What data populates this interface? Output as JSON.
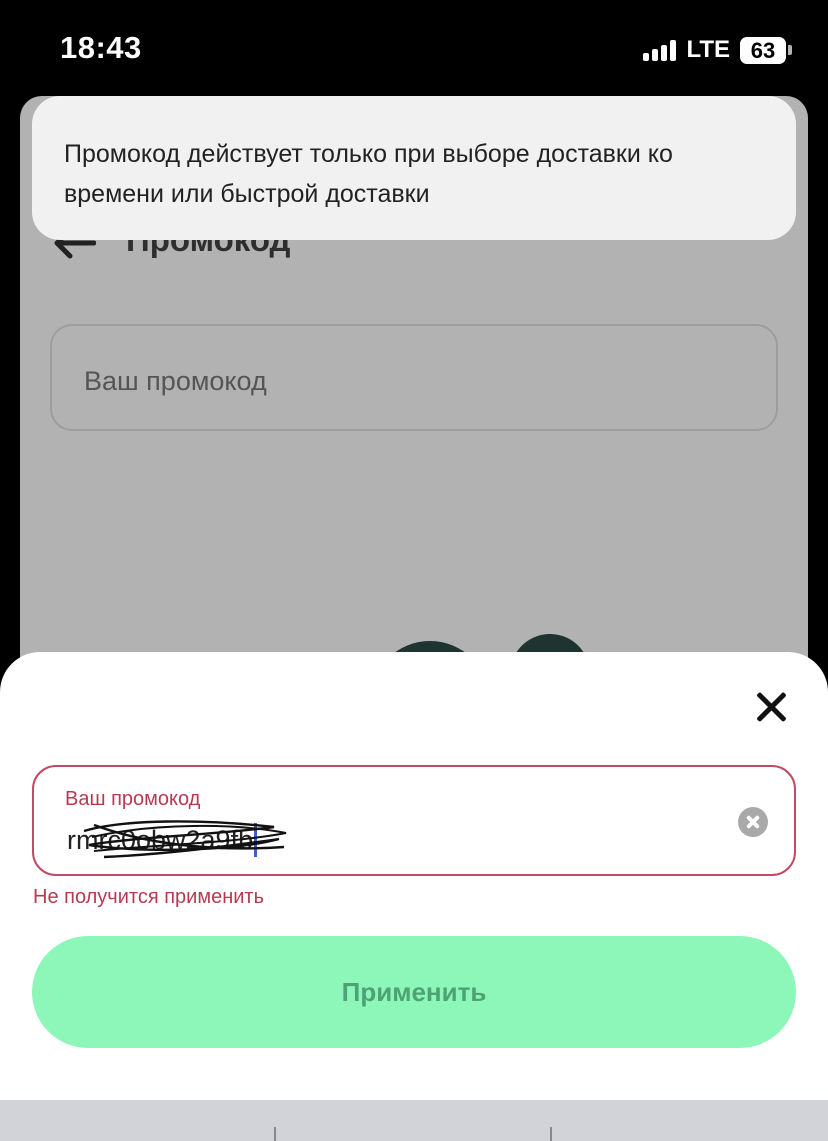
{
  "status_bar": {
    "time": "18:43",
    "network": "LTE",
    "battery": "63"
  },
  "background_page": {
    "title": "Промокод",
    "input_placeholder": "Ваш промокод"
  },
  "toast": {
    "message": "Промокод действует только при выборе доставки ко времени или быстрой доставки"
  },
  "sheet": {
    "field_label": "Ваш промокод",
    "field_value": "rmrc0obw2a9fb",
    "error_text": "Не получится применить",
    "apply_label": "Применить"
  },
  "colors": {
    "accent_button": "#8cf7b8",
    "error": "#b83a52"
  }
}
